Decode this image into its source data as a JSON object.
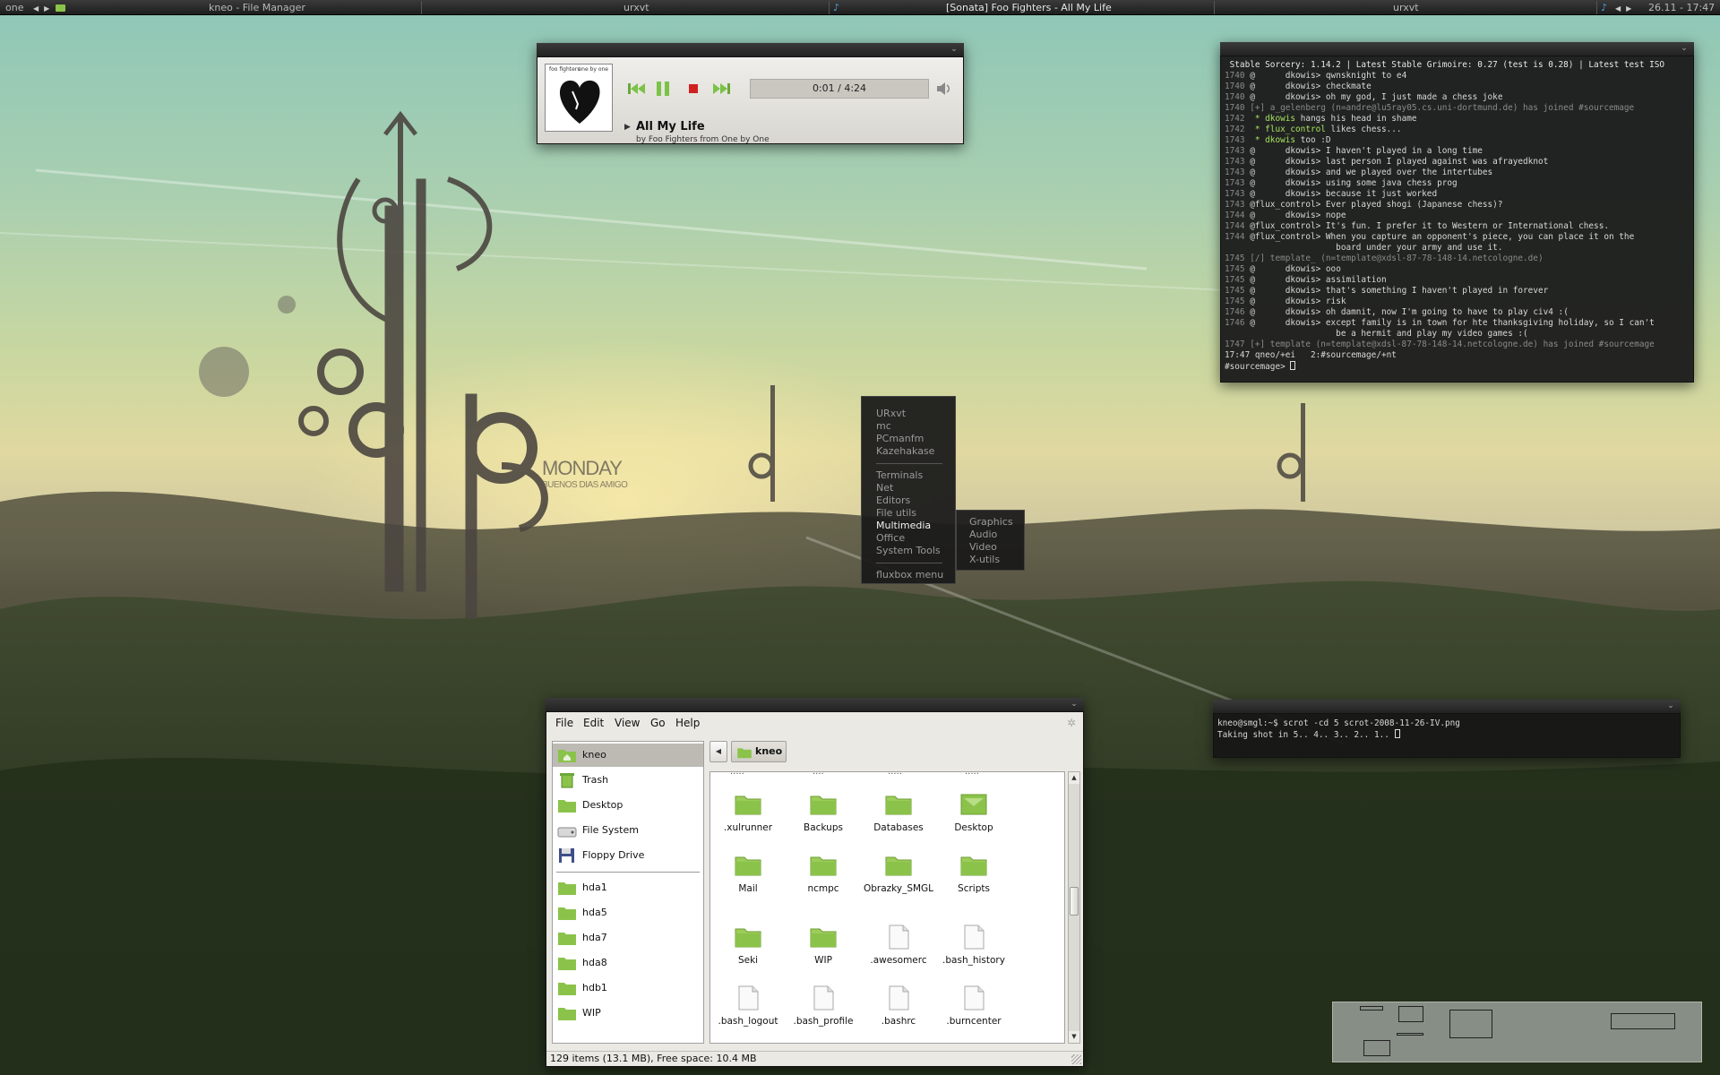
{
  "panel": {
    "workspace": "one",
    "task_filemanager": "kneo - File Manager",
    "task_urxvt1": "urxvt",
    "task_sonata": "[Sonata] Foo Fighters - All My Life",
    "task_urxvt2": "urxvt",
    "clock": "26.11 - 17:47"
  },
  "wallpaper": {
    "heading": "MONDAY",
    "subheading": "BUENOS DIAS AMIGO"
  },
  "sonata": {
    "time": "0:01 / 4:24",
    "title": "All My Life",
    "byline": "by Foo Fighters from One by One",
    "cover_top": "foo fighters",
    "cover_right": "one by one"
  },
  "irc": {
    "lines": [
      {
        "t": "",
        "n": "",
        "m": " Stable Sorcery: 1.14.2 | Latest Stable Grimoire: 0.27 (test is 0.28) | Latest test ISO",
        "k": "topic"
      },
      {
        "t": "1740",
        "n": "@      dkowis>",
        "m": " qwnsknight to e4"
      },
      {
        "t": "1740",
        "n": "@      dkowis>",
        "m": " checkmate"
      },
      {
        "t": "1740",
        "n": "@      dkowis>",
        "m": " oh my god, I just made a chess joke"
      },
      {
        "t": "1740",
        "n": "[+] a_gelenberg (n=andre@lu5ray05.cs.uni-dortmund.de) has joined #sourcemage",
        "m": "",
        "k": "dim"
      },
      {
        "t": "1742",
        "n": " * dkowis",
        "m": " hangs his head in shame",
        "k": "act"
      },
      {
        "t": "1742",
        "n": " * flux_control",
        "m": " likes chess...",
        "k": "act"
      },
      {
        "t": "1743",
        "n": " * dkowis",
        "m": " too :D",
        "k": "act"
      },
      {
        "t": "1743",
        "n": "@      dkowis>",
        "m": " I haven't played in a long time"
      },
      {
        "t": "1743",
        "n": "@      dkowis>",
        "m": " last person I played against was afrayedknot"
      },
      {
        "t": "1743",
        "n": "@      dkowis>",
        "m": " and we played over the intertubes"
      },
      {
        "t": "1743",
        "n": "@      dkowis>",
        "m": " using some java chess prog"
      },
      {
        "t": "1743",
        "n": "@      dkowis>",
        "m": " because it just worked"
      },
      {
        "t": "1743",
        "n": "@flux_control>",
        "m": " Ever played shogi (Japanese chess)?"
      },
      {
        "t": "1744",
        "n": "@      dkowis>",
        "m": " nope"
      },
      {
        "t": "1744",
        "n": "@flux_control>",
        "m": " It's fun. I prefer it to Western or International chess."
      },
      {
        "t": "1744",
        "n": "@flux_control>",
        "m": " When you capture an opponent's piece, you can place it on the"
      },
      {
        "t": "",
        "n": "",
        "m": "                      board under your army and use it."
      },
      {
        "t": "1745",
        "n": "[/] template_ (n=template@xdsl-87-78-148-14.netcologne.de)",
        "m": "",
        "k": "dim"
      },
      {
        "t": "1745",
        "n": "@      dkowis>",
        "m": " ooo"
      },
      {
        "t": "1745",
        "n": "@      dkowis>",
        "m": " assimilation"
      },
      {
        "t": "1745",
        "n": "@      dkowis>",
        "m": " that's something I haven't played in forever"
      },
      {
        "t": "1745",
        "n": "@      dkowis>",
        "m": " risk"
      },
      {
        "t": "1746",
        "n": "@      dkowis>",
        "m": " oh damnit, now I'm going to have to play civ4 :("
      },
      {
        "t": "1746",
        "n": "@      dkowis>",
        "m": " except family is in town for hte thanksgiving holiday, so I can't"
      },
      {
        "t": "",
        "n": "",
        "m": "                      be a hermit and play my video games :("
      },
      {
        "t": "1747",
        "n": "[+] template (n=template@xdsl-87-78-148-14.netcologne.de) has joined #sourcemage",
        "m": "",
        "k": "dim"
      }
    ],
    "status_line": "17:47 qneo/+ei   2:#sourcemage/+nt",
    "prompt": "#sourcemage> "
  },
  "term2": {
    "line1": "kneo@smgl:~$ scrot -cd 5 scrot-2008-11-26-IV.png",
    "line2": "Taking shot in 5.. 4.. 3.. 2.. 1.. "
  },
  "fbmenu": {
    "items": [
      "URxvt",
      "mc",
      "PCmanfm",
      "Kazehakase"
    ],
    "groups": [
      "Terminals",
      "Net",
      "Editors",
      "File utils",
      "Multimedia",
      "Office",
      "System Tools"
    ],
    "footer": "fluxbox menu",
    "submenu": [
      "Graphics",
      "Audio",
      "Video",
      "X-utils"
    ]
  },
  "fm": {
    "menu": [
      "File",
      "Edit",
      "View",
      "Go",
      "Help"
    ],
    "places": [
      {
        "label": "kneo",
        "icon": "home-folder-icon"
      },
      {
        "label": "Trash",
        "icon": "trash-icon"
      },
      {
        "label": "Desktop",
        "icon": "desktop-folder-icon"
      },
      {
        "label": "File System",
        "icon": "harddisk-icon"
      },
      {
        "label": "Floppy Drive",
        "icon": "floppy-icon"
      }
    ],
    "volumes": [
      "hda1",
      "hda5",
      "hda7",
      "hda8",
      "hdb1",
      "WIP"
    ],
    "path": "kneo",
    "files": [
      {
        "label": ".xulrunner",
        "type": "folder"
      },
      {
        "label": "Backups",
        "type": "folder"
      },
      {
        "label": "Databases",
        "type": "folder"
      },
      {
        "label": "Desktop",
        "type": "desktop"
      },
      {
        "label": "Mail",
        "type": "folder"
      },
      {
        "label": "ncmpc",
        "type": "folder"
      },
      {
        "label": "Obrazky_SMGL",
        "type": "folder"
      },
      {
        "label": "Scripts",
        "type": "folder"
      },
      {
        "label": "Seki",
        "type": "folder"
      },
      {
        "label": "WIP",
        "type": "folder"
      },
      {
        "label": ".awesomerc",
        "type": "file"
      },
      {
        "label": ".bash_history",
        "type": "file"
      },
      {
        "label": ".bash_logout",
        "type": "file"
      },
      {
        "label": ".bash_profile",
        "type": "file"
      },
      {
        "label": ".bashrc",
        "type": "file"
      },
      {
        "label": ".burncenter",
        "type": "file"
      }
    ],
    "status": "129 items (13.1 MB), Free space: 10.4 MB"
  },
  "colors": {
    "accent_green": "#8bc34a",
    "irc_green": "#a8e060"
  }
}
